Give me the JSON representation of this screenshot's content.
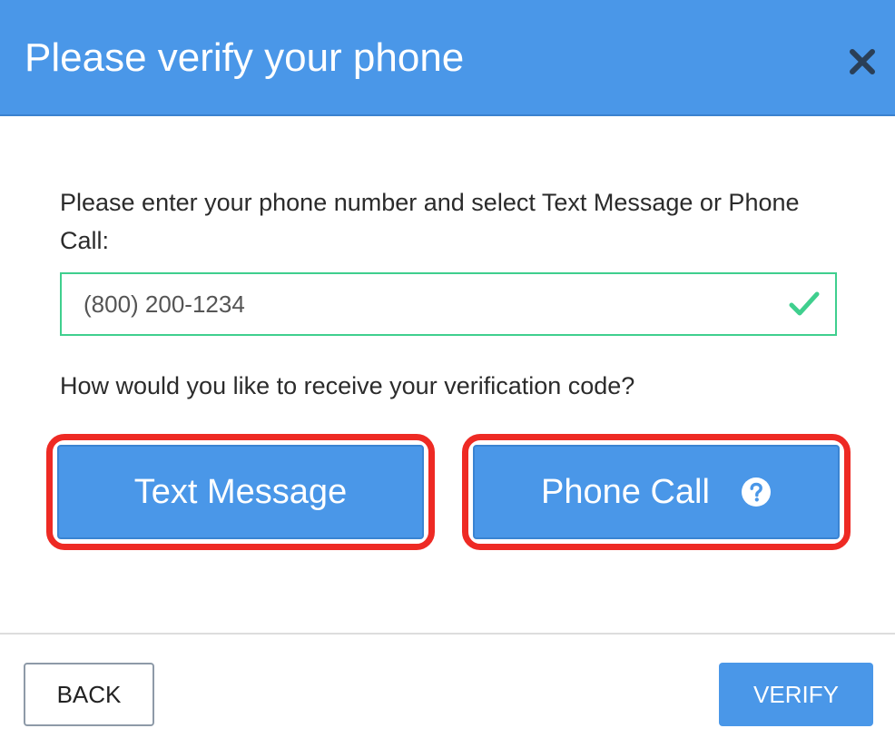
{
  "header": {
    "title": "Please verify your phone",
    "close_icon": "close-icon",
    "background_color": "#4a97e8"
  },
  "form": {
    "instructions": "Please enter your phone number and select Text Message or Phone Call:",
    "phone_value": "(800) 200-1234",
    "valid_icon": "checkmark-icon",
    "valid_color": "#3fcf8e",
    "question": "How would you like to receive your verification code?"
  },
  "options": {
    "text_message_label": "Text Message",
    "phone_call_label": "Phone Call",
    "help_icon": "question-circle-icon",
    "highlight_color": "#ee2a24"
  },
  "footer": {
    "back_label": "BACK",
    "verify_label": "VERIFY"
  }
}
